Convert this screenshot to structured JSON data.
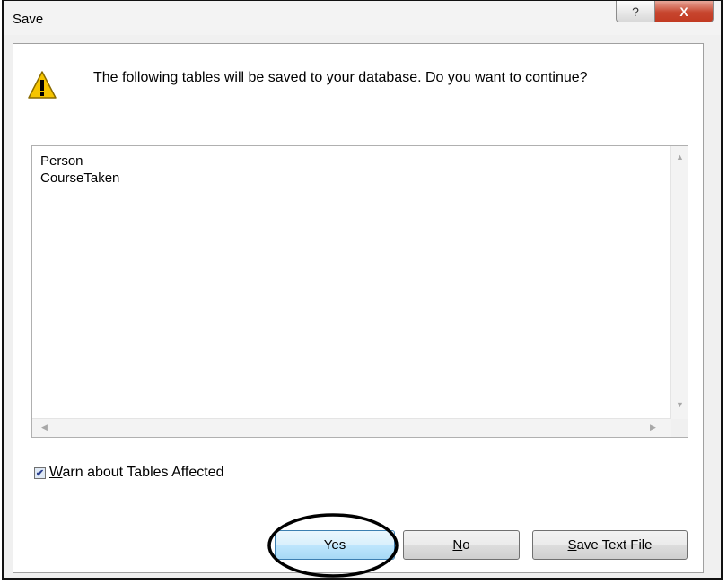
{
  "window": {
    "title": "Save",
    "help_label": "?",
    "close_label": "X"
  },
  "message": "The following tables will be saved to your database. Do you want to continue?",
  "tables": [
    "Person",
    "CourseTaken"
  ],
  "checkbox": {
    "label": "Warn about Tables Affected",
    "checked": true
  },
  "buttons": {
    "yes": "Yes",
    "no": "No",
    "save_text_file": "Save Text File"
  },
  "icons": {
    "warning": "warning-triangle-icon"
  },
  "colors": {
    "warning_yellow": "#f5c400",
    "default_button_border": "#3c7fb1",
    "close_red": "#c7462f",
    "annotation": "#000000"
  }
}
